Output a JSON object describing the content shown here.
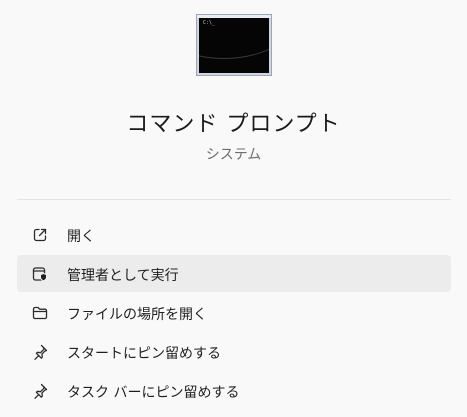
{
  "app": {
    "name": "コマンド プロンプト",
    "category": "システム",
    "icon": "command-prompt-icon",
    "icon_prompt_text": "C:\\_"
  },
  "menu": {
    "items": [
      {
        "label": "開く",
        "icon": "open-external-icon"
      },
      {
        "label": "管理者として実行",
        "icon": "run-as-admin-shield-icon"
      },
      {
        "label": "ファイルの場所を開く",
        "icon": "folder-icon"
      },
      {
        "label": "スタートにピン留めする",
        "icon": "pin-icon"
      },
      {
        "label": "タスク バーにピン留めする",
        "icon": "pin-icon"
      }
    ],
    "hovered_index": 1
  }
}
